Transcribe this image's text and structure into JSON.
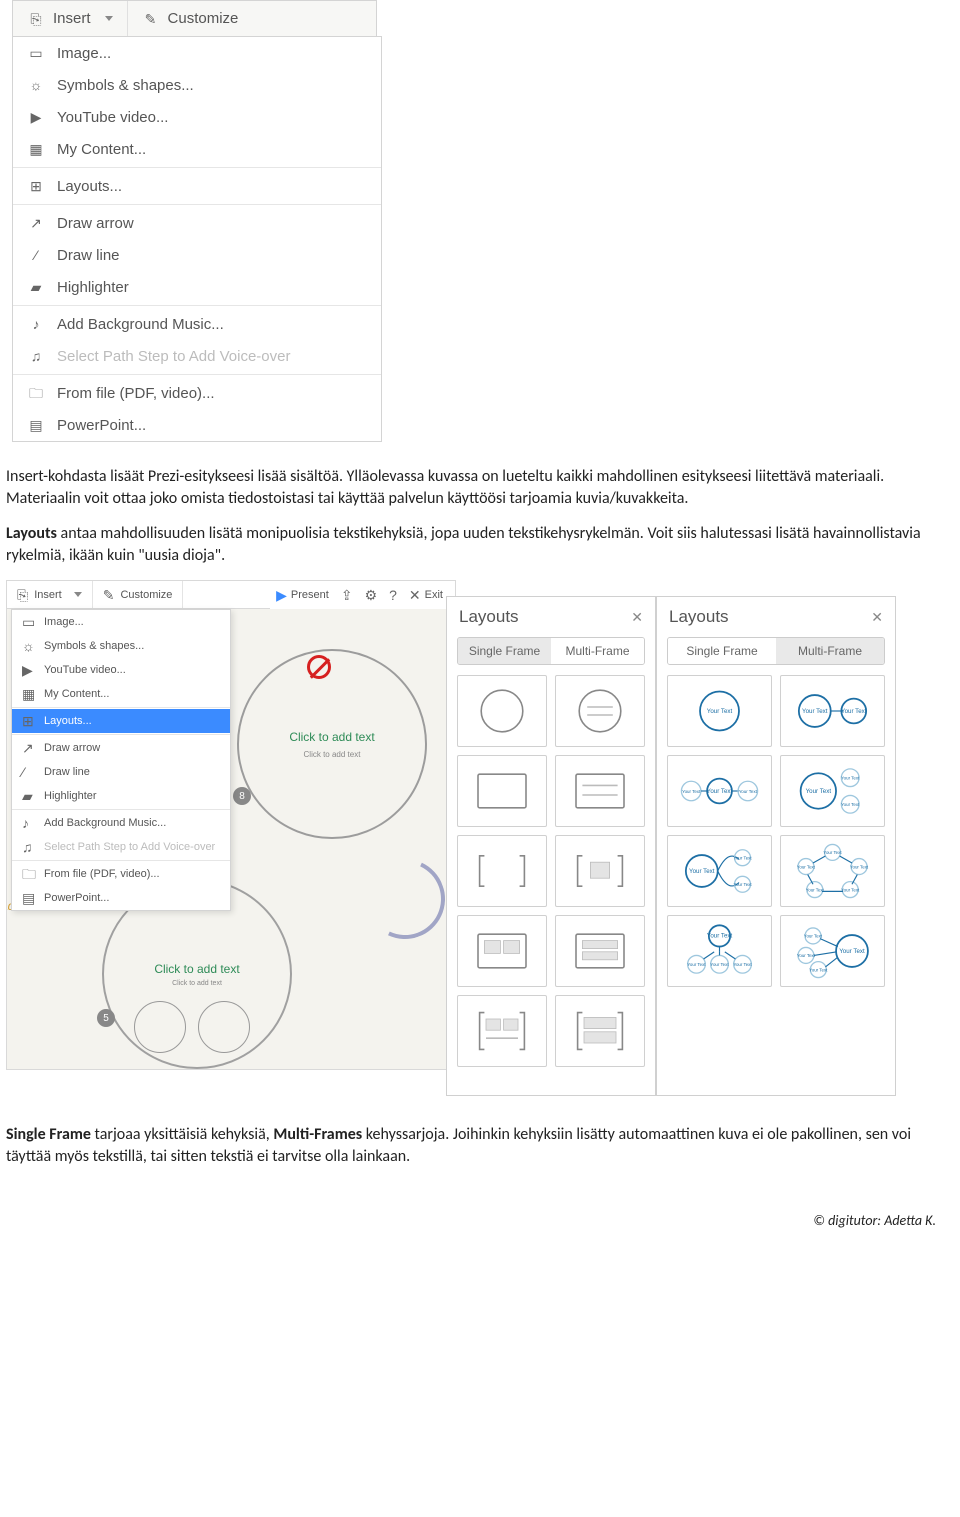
{
  "toolbar": {
    "insert_label": "Insert",
    "customize_label": "Customize"
  },
  "menu_items": [
    {
      "label": "Image...",
      "icon": "image-icon",
      "disabled": false
    },
    {
      "label": "Symbols & shapes...",
      "icon": "bulb-icon",
      "disabled": false
    },
    {
      "label": "YouTube video...",
      "icon": "youtube-icon",
      "disabled": false
    },
    {
      "label": "My Content...",
      "icon": "content-icon",
      "disabled": false
    },
    {
      "sep": true
    },
    {
      "label": "Layouts...",
      "icon": "layouts-icon",
      "disabled": false
    },
    {
      "sep": true
    },
    {
      "label": "Draw arrow",
      "icon": "arrow-icon",
      "disabled": false
    },
    {
      "label": "Draw line",
      "icon": "line-icon",
      "disabled": false
    },
    {
      "label": "Highlighter",
      "icon": "highlighter-icon",
      "disabled": false
    },
    {
      "sep": true
    },
    {
      "label": "Add Background Music...",
      "icon": "music-icon",
      "disabled": false
    },
    {
      "label": "Select Path Step to Add Voice-over",
      "icon": "voice-icon",
      "disabled": true
    },
    {
      "sep": true
    },
    {
      "label": "From file (PDF, video)...",
      "icon": "file-icon",
      "disabled": false
    },
    {
      "label": "PowerPoint...",
      "icon": "ppt-icon",
      "disabled": false
    }
  ],
  "paragraphs": {
    "p1_a": "Insert-kohdasta lisäät Prezi-esitykseesi lisää sisältöä. Ylläolevassa kuvassa on lueteltu kaikki mahdollinen esitykseesi liitettävä materiaali. Materiaalin voit ottaa joko omista tiedostoistasi tai käyttää palvelun käyttöösi tarjoamia kuvia/kuvakkeita.",
    "p2_bold": "Layouts",
    "p2_a": " antaa mahdollisuuden lisätä monipuolisia tekstikehyksiä, jopa uuden tekstikehysrykelmän. Voit siis halutessasi lisätä havainnollistavia rykelmiä, ikään kuin \"uusia dioja\".",
    "p3_b1": "Single Frame",
    "p3_a": " tarjoaa yksittäisiä kehyksiä, ",
    "p3_b2": "Multi-Frames",
    "p3_b": " kehyssarjoja. Joihinkin kehyksiin lisätty automaattinen kuva ei ole pakollinen, sen voi täyttää myös tekstillä, tai sitten tekstiä ei tarvitse olla lainkaan."
  },
  "editor": {
    "toolbar": {
      "insert": "Insert",
      "customize": "Customize"
    },
    "right": {
      "present": "Present",
      "exit": "Exit"
    },
    "menu": [
      {
        "label": "Image...",
        "icon": "image-icon"
      },
      {
        "label": "Symbols & shapes...",
        "icon": "bulb-icon"
      },
      {
        "label": "YouTube video...",
        "icon": "youtube-icon"
      },
      {
        "label": "My Content...",
        "icon": "content-icon"
      },
      {
        "sep": true
      },
      {
        "label": "Layouts...",
        "icon": "layouts-icon",
        "selected": true
      },
      {
        "sep": true
      },
      {
        "label": "Draw arrow",
        "icon": "arrow-icon"
      },
      {
        "label": "Draw line",
        "icon": "line-icon"
      },
      {
        "label": "Highlighter",
        "icon": "highlighter-icon"
      },
      {
        "sep": true
      },
      {
        "label": "Add Background Music...",
        "icon": "music-icon"
      },
      {
        "label": "Select Path Step to Add Voice-over",
        "icon": "voice-icon",
        "disabled": true
      },
      {
        "sep": true
      },
      {
        "label": "From file (PDF, video)...",
        "icon": "file-icon"
      },
      {
        "label": "PowerPoint...",
        "icon": "ppt-icon"
      }
    ],
    "canvas": {
      "click_to_add": "Click to add text",
      "sub": "Click to add text",
      "addtext": "add text",
      "num8": "8",
      "num5": "5"
    }
  },
  "layouts_panel": {
    "title": "Layouts",
    "tab_single": "Single Frame",
    "tab_multi": "Multi-Frame",
    "your_text": "Your Text"
  },
  "footer": "© digitutor: Adetta K."
}
